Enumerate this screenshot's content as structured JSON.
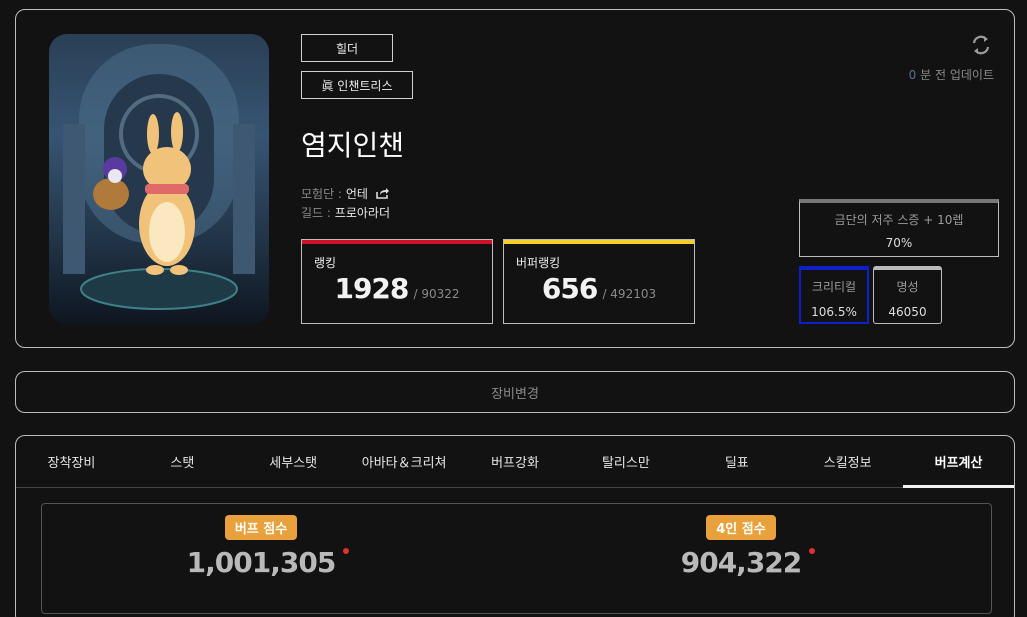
{
  "profile": {
    "job_tag": "힐더",
    "class_tag": "眞 인챈트리스",
    "character_name": "염지인챈",
    "adventure_label": "모험단 :",
    "adventure_name": "언테",
    "guild_label": "길드 :",
    "guild_name": "프로아라더",
    "update_count": "0",
    "update_text": "분 전 업데이트",
    "rank": {
      "label": "랭킹",
      "value": "1928",
      "total": "/ 90322",
      "color": "#d0102a"
    },
    "buff_rank": {
      "label": "버퍼랭킹",
      "value": "656",
      "total": "/ 492103",
      "color": "#f5cf2a"
    },
    "curse": {
      "label": "금단의 저주 스증 + 10렙",
      "value": "70%"
    },
    "crit": {
      "label": "크리티컬",
      "value": "106.5%"
    },
    "fame": {
      "label": "명성",
      "value": "46050"
    }
  },
  "equip_change_label": "장비변경",
  "tabs": [
    {
      "label": "장착장비"
    },
    {
      "label": "스탯"
    },
    {
      "label": "세부스탯"
    },
    {
      "label": "아바타＆크리쳐"
    },
    {
      "label": "버프강화"
    },
    {
      "label": "탈리스만"
    },
    {
      "label": "딜표"
    },
    {
      "label": "스킬정보"
    },
    {
      "label": "버프계산",
      "active": true
    }
  ],
  "scores": {
    "buff": {
      "label": "버프 점수",
      "value": "1,001,305"
    },
    "party": {
      "label": "4인 점수",
      "value": "904,322"
    }
  }
}
